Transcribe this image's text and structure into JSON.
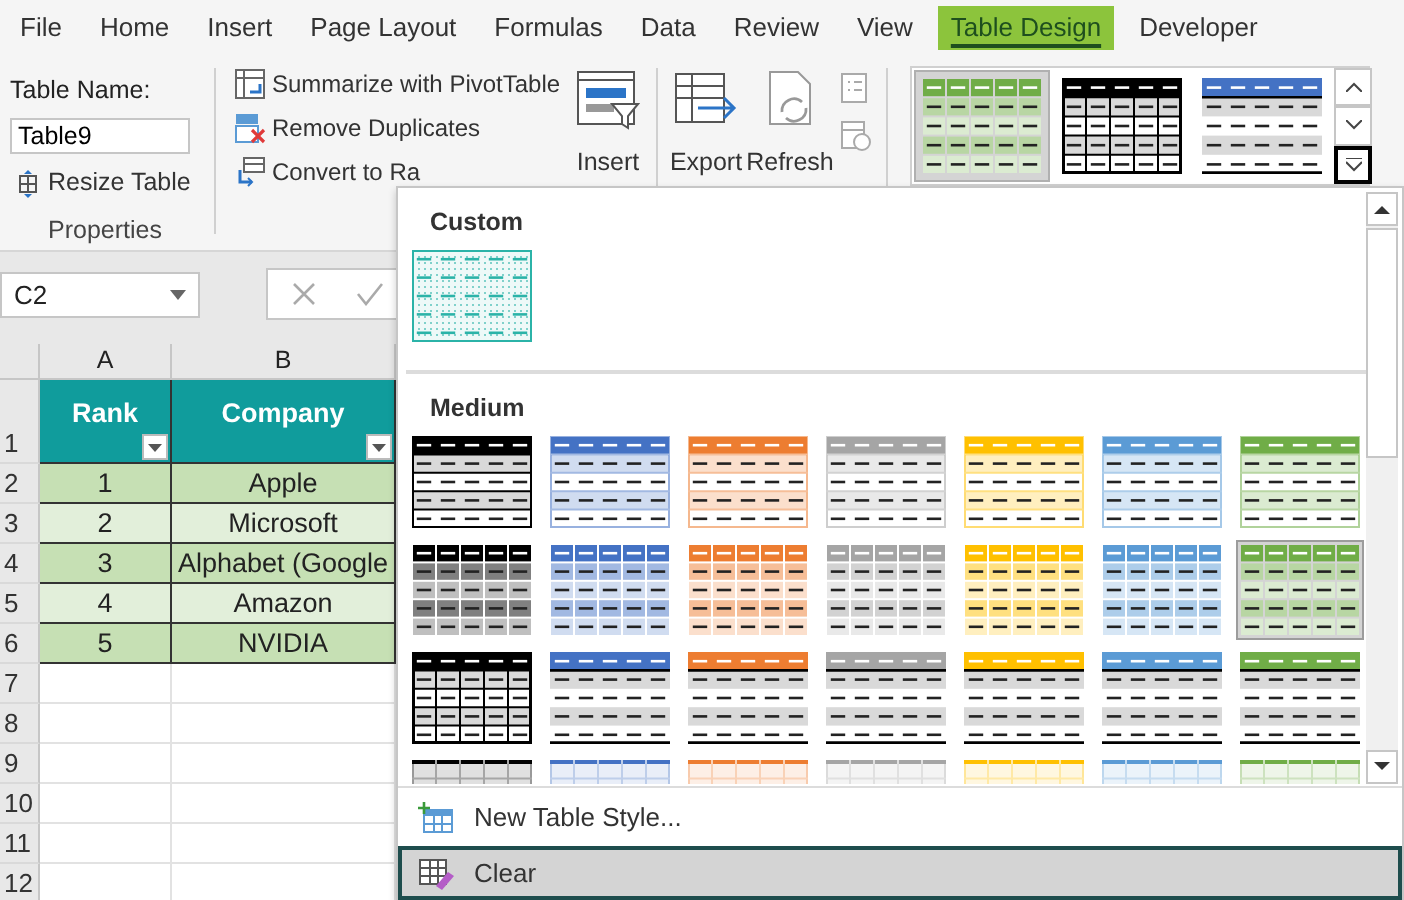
{
  "menu_tabs": [
    {
      "label": "File",
      "selected": false
    },
    {
      "label": "Home",
      "selected": false
    },
    {
      "label": "Insert",
      "selected": false
    },
    {
      "label": "Page Layout",
      "selected": false
    },
    {
      "label": "Formulas",
      "selected": false
    },
    {
      "label": "Data",
      "selected": false
    },
    {
      "label": "Review",
      "selected": false
    },
    {
      "label": "View",
      "selected": false
    },
    {
      "label": "Table Design",
      "selected": true
    },
    {
      "label": "Developer",
      "selected": false
    }
  ],
  "ribbon": {
    "properties_group": {
      "table_name_label": "Table Name:",
      "table_name": "Table9",
      "resize_button": "Resize Table",
      "group_label": "Properties"
    },
    "tools": [
      {
        "label": "Summarize with PivotTable",
        "kind": "pivot"
      },
      {
        "label": "Remove Duplicates",
        "kind": "duplicates"
      },
      {
        "label": "Convert to Ra",
        "kind": "convert"
      }
    ],
    "large_buttons": [
      {
        "label": "Insert",
        "kind": "slicer"
      },
      {
        "label": "Export",
        "kind": "export"
      },
      {
        "label": "Refresh",
        "kind": "refresh"
      }
    ],
    "style_gallery": [
      {
        "kind": "grid",
        "color": "#70ad47",
        "selected": true
      },
      {
        "kind": "header_line",
        "color": "#000000",
        "selected": false
      },
      {
        "kind": "header_line",
        "color": "#4472c4",
        "selected": false
      }
    ]
  },
  "name_box": "C2",
  "sheet": {
    "columns": [
      "A",
      "B"
    ],
    "row_numbers": [
      "1",
      "2",
      "3",
      "4",
      "5",
      "6",
      "7",
      "8",
      "9",
      "10",
      "11",
      "12"
    ],
    "table_headers": [
      "Rank",
      "Company"
    ],
    "table_rows": [
      [
        "1",
        "Apple"
      ],
      [
        "2",
        "Microsoft"
      ],
      [
        "3",
        "Alphabet (Google"
      ],
      [
        "4",
        "Amazon"
      ],
      [
        "5",
        "NVIDIA"
      ]
    ]
  },
  "style_menu": {
    "sections": [
      {
        "title": "Custom",
        "styles": [
          {
            "kind": "custom",
            "color": "#2bb3a8",
            "selected": false
          }
        ]
      },
      {
        "title": "Medium",
        "styles": [
          {
            "kind": "banded",
            "color": "#000000",
            "selected": false
          },
          {
            "kind": "banded",
            "color": "#4472c4",
            "selected": false
          },
          {
            "kind": "banded",
            "color": "#ed7d31",
            "selected": false
          },
          {
            "kind": "banded",
            "color": "#a5a5a5",
            "selected": false
          },
          {
            "kind": "banded",
            "color": "#ffc000",
            "selected": false
          },
          {
            "kind": "banded",
            "color": "#5b9bd5",
            "selected": false
          },
          {
            "kind": "banded",
            "color": "#70ad47",
            "selected": false
          },
          {
            "kind": "grid",
            "color": "#000000",
            "selected": false
          },
          {
            "kind": "grid",
            "color": "#4472c4",
            "selected": false
          },
          {
            "kind": "grid",
            "color": "#ed7d31",
            "selected": false
          },
          {
            "kind": "grid",
            "color": "#a5a5a5",
            "selected": false
          },
          {
            "kind": "grid",
            "color": "#ffc000",
            "selected": false
          },
          {
            "kind": "grid",
            "color": "#5b9bd5",
            "selected": false
          },
          {
            "kind": "grid",
            "color": "#70ad47",
            "selected": true
          },
          {
            "kind": "header_line",
            "color": "#000000",
            "selected": false
          },
          {
            "kind": "header_line",
            "color": "#4472c4",
            "selected": false
          },
          {
            "kind": "header_line",
            "color": "#ed7d31",
            "selected": false
          },
          {
            "kind": "header_line",
            "color": "#a5a5a5",
            "selected": false
          },
          {
            "kind": "header_line",
            "color": "#ffc000",
            "selected": false
          },
          {
            "kind": "header_line",
            "color": "#5b9bd5",
            "selected": false
          },
          {
            "kind": "header_line",
            "color": "#70ad47",
            "selected": false
          },
          {
            "kind": "light",
            "color": "#000000",
            "selected": false
          },
          {
            "kind": "light",
            "color": "#4472c4",
            "selected": false
          },
          {
            "kind": "light",
            "color": "#ed7d31",
            "selected": false
          },
          {
            "kind": "light",
            "color": "#a5a5a5",
            "selected": false
          },
          {
            "kind": "light",
            "color": "#ffc000",
            "selected": false
          },
          {
            "kind": "light",
            "color": "#5b9bd5",
            "selected": false
          },
          {
            "kind": "light",
            "color": "#70ad47",
            "selected": false
          }
        ]
      }
    ],
    "commands": [
      {
        "label": "New Table Style...",
        "kind": "new",
        "selected": false
      },
      {
        "label": "Clear",
        "kind": "clear",
        "selected": true
      }
    ]
  }
}
